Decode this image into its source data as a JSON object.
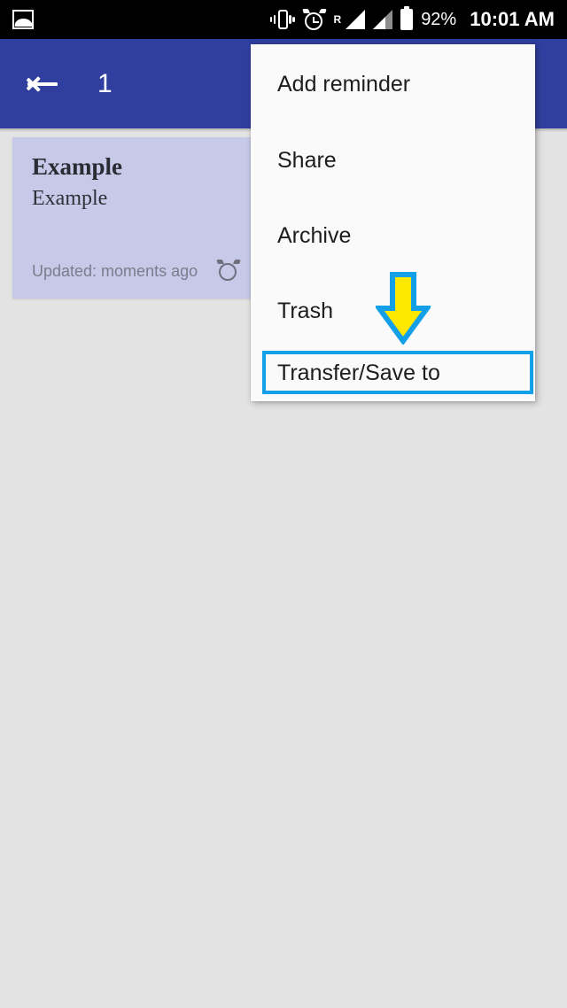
{
  "status_bar": {
    "left_icons": [
      {
        "name": "photo-icon",
        "label": "photo"
      }
    ],
    "right_icons": [
      {
        "name": "vibrate-icon",
        "label": "vibrate"
      },
      {
        "name": "alarm-icon",
        "label": "alarm"
      },
      {
        "name": "roaming-signal-icon",
        "label": "R"
      },
      {
        "name": "signal-icon",
        "label": "signal"
      },
      {
        "name": "battery-icon",
        "label": "battery"
      }
    ],
    "roaming_label": "R",
    "battery_percent": "92%",
    "clock": "10:01 AM",
    "background_color": "#000000",
    "text_color": "#ffffff"
  },
  "app_bar": {
    "title": "1",
    "back_icon": "back-arrow-icon",
    "background_color": "#303f9f",
    "text_color": "#ffffff"
  },
  "note_card": {
    "title": "Example",
    "body": "Example",
    "updated": "Updated: moments ago",
    "alarm_icon": "alarm-icon",
    "background_color": "#c6c9e8",
    "title_color": "#2b2b33",
    "meta_color": "#7c7c8c"
  },
  "popup_menu": {
    "background_color": "#fafafa",
    "text_color": "#1d1d1d",
    "items": [
      {
        "label": "Add reminder"
      },
      {
        "label": "Share"
      },
      {
        "label": "Archive"
      },
      {
        "label": "Trash"
      },
      {
        "label": "Transfer/Save to"
      }
    ]
  },
  "annotations": {
    "highlight_target": "Transfer/Save to",
    "highlight_color": "#14a0e8",
    "arrow_fill_color": "#ffe800",
    "arrow_stroke_color": "#14a0e8",
    "arrow_direction": "down"
  },
  "page_background_color": "#e3e3e3"
}
